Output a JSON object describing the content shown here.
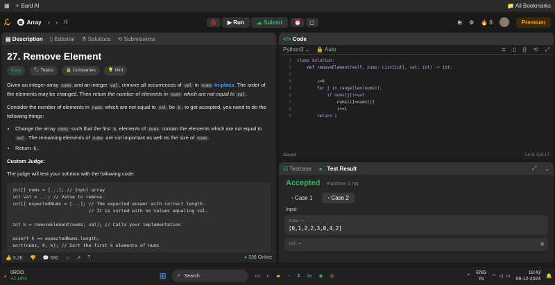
{
  "bookmarks": {
    "left_item": "Bard AI",
    "right_item": "All Bookmarks"
  },
  "nav": {
    "problem_list": "Array",
    "run": "Run",
    "submit": "Submit",
    "streak": "0",
    "premium": "Premium"
  },
  "left": {
    "tabs": [
      "Description",
      "Editorial",
      "Solutions",
      "Submissions"
    ],
    "title": "27. Remove Element",
    "chips": [
      "Easy",
      "Topics",
      "Companies",
      "Hint"
    ],
    "p1a": "Given an integer array ",
    "p1b": "nums",
    "p1c": " and an integer ",
    "p1d": "val",
    "p1e": ", remove all occurrences of ",
    "p1f": "val",
    "p1g": " in ",
    "p1h": "nums",
    "p1i": " in-place",
    "p1j": ". The order of the elements may be changed. Then return ",
    "p1k": "the number of elements in ",
    "p1l": "nums",
    "p1m": " which are not equal to ",
    "p1n": "val",
    "p1o": ".",
    "p2a": "Consider the number of elements in ",
    "p2b": "nums",
    "p2c": " which are not equal to ",
    "p2d": "val",
    "p2e": " be ",
    "p2f": "k",
    "p2g": ", to get accepted, you need to do the following things:",
    "li1a": "Change the array ",
    "li1b": "nums",
    "li1c": " such that the first ",
    "li1d": "k",
    "li1e": " elements of ",
    "li1f": "nums",
    "li1g": " contain the elements which are not equal to ",
    "li1h": "val",
    "li1i": ". The remaining elements of ",
    "li1j": "nums",
    "li1k": " are not important as well as the size of ",
    "li1l": "nums",
    "li1m": ".",
    "li2a": "Return ",
    "li2b": "k",
    "li2c": ".",
    "judge_title": "Custom Judge:",
    "judge_text": "The judge will test your solution with the following code:",
    "code": "int[] nums = [...]; // Input array\nint val = ...; // Value to remove\nint[] expectedNums = [...]; // The expected answer with correct length.\n                            // It is sorted with no values equaling val.\n\nint k = removeElement(nums, val); // Calls your implementation\n\nassert k == expectedNums.length;\nsort(nums, 0, k); // Sort the first k elements of nums",
    "likes": "3.2K",
    "comments": "590",
    "online": "336 Online"
  },
  "code": {
    "title": "Code",
    "lang": "Python3",
    "mode": "Auto",
    "lines": [
      "class Solution:",
      "    def removeElement(self, nums: List[int], val: int) -> int:",
      "",
      "        i=0",
      "        for j in range(len(nums)):",
      "            if nums[j]!=val:",
      "                nums[i]=nums[j]",
      "                i+=1",
      "        return i"
    ],
    "saved": "Saved",
    "cursor": "Ln 9, Col 17"
  },
  "test": {
    "tabs": [
      "Testcase",
      "Test Result"
    ],
    "status": "Accepted",
    "runtime": "Runtime: 0 ms",
    "cases": [
      "Case 1",
      "Case 2"
    ],
    "input_label": "Input",
    "nums_label": "nums =",
    "nums_value": "[0,1,2,2,3,0,4,2]",
    "val_label": "val ="
  },
  "taskbar": {
    "stock": "0RDO",
    "stock_change": "+2.19%",
    "search": "Search",
    "lang": "ENG",
    "lang2": "IN",
    "time": "18:43",
    "date": "06-12-2024"
  },
  "colors": {
    "accent": "#ffa116",
    "green": "#2cbb5d",
    "blue": "#4a9eff"
  }
}
